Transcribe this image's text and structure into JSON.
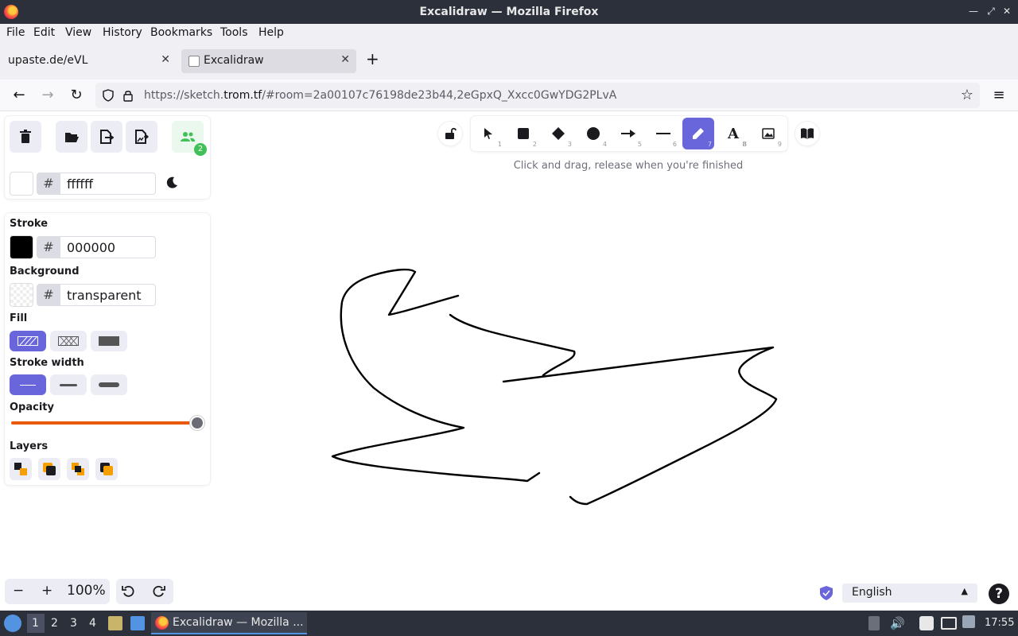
{
  "window": {
    "title": "Excalidraw — Mozilla Firefox"
  },
  "menu": [
    "File",
    "Edit",
    "View",
    "History",
    "Bookmarks",
    "Tools",
    "Help"
  ],
  "tabs": [
    {
      "label": "upaste.de/eVL",
      "active": false
    },
    {
      "label": "Excalidraw",
      "active": true
    }
  ],
  "url": {
    "prefix": "https://sketch.",
    "host": "trom.tf",
    "path": "/#room=2a00107c76198de23b44,2eGpxQ_Xxcc0GwYDG2PLvA"
  },
  "app": {
    "collab_count": "2",
    "canvas_bg": "ffffff",
    "stroke_label": "Stroke",
    "stroke_value": "000000",
    "background_label": "Background",
    "background_value": "transparent",
    "fill_label": "Fill",
    "stroke_width_label": "Stroke width",
    "opacity_label": "Opacity",
    "opacity_value": 100,
    "layers_label": "Layers",
    "hint": "Click and drag, release when you're finished",
    "zoom": "100%",
    "language": "English",
    "accent": "#6965db"
  },
  "tools": [
    {
      "name": "selection",
      "num": "1",
      "icon": "pointer-icon"
    },
    {
      "name": "rectangle",
      "num": "2",
      "icon": "rectangle-icon"
    },
    {
      "name": "diamond",
      "num": "3",
      "icon": "diamond-icon"
    },
    {
      "name": "ellipse",
      "num": "4",
      "icon": "ellipse-icon"
    },
    {
      "name": "arrow",
      "num": "5",
      "icon": "arrow-icon"
    },
    {
      "name": "line",
      "num": "6",
      "icon": "line-icon"
    },
    {
      "name": "draw",
      "num": "7",
      "icon": "pencil-icon",
      "selected": true
    },
    {
      "name": "text",
      "num": "8",
      "icon": "text-icon"
    },
    {
      "name": "image",
      "num": "9",
      "icon": "image-icon"
    }
  ],
  "taskbar": {
    "workspaces": [
      "1",
      "2",
      "3",
      "4"
    ],
    "task_label": "Excalidraw — Mozilla ...",
    "clock": "17:55"
  }
}
